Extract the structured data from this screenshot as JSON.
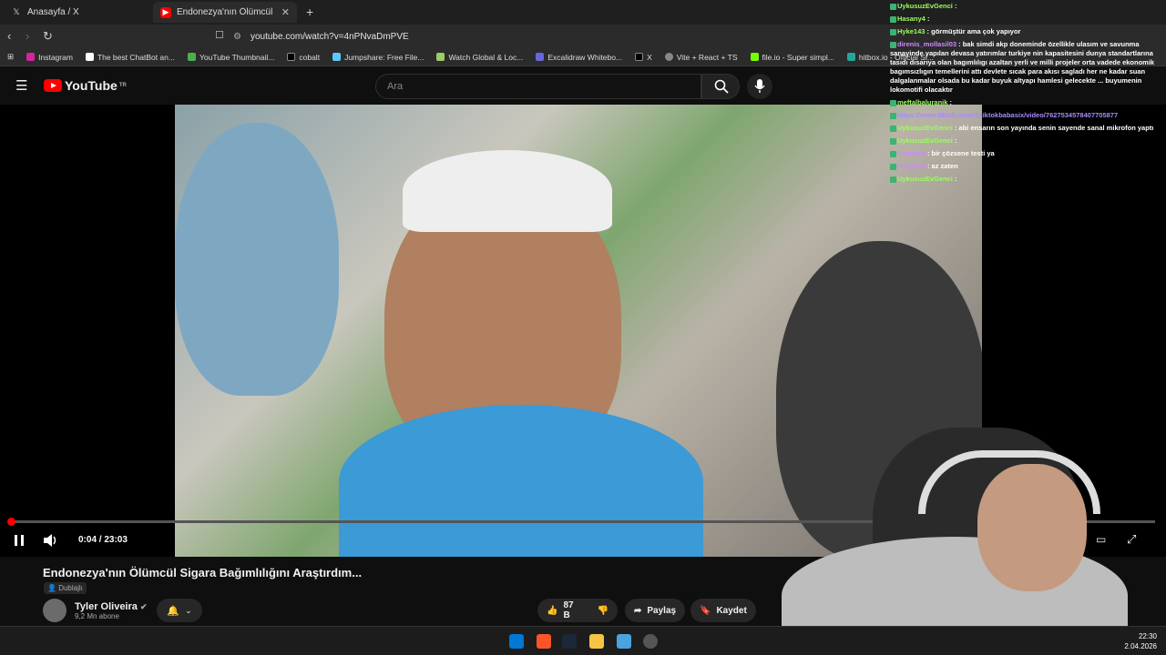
{
  "browser": {
    "tabs": [
      {
        "label": "Anasayfa / X"
      },
      {
        "label": "Endonezya'nın Ölümcül Sigar"
      }
    ],
    "url": "youtube.com/watch?v=4nPNvaDmPVE",
    "bookmarks": [
      "Instagram",
      "The best ChatBot an...",
      "YouTube Thumbnail...",
      "cobalt",
      "Jumpshare: Free File...",
      "Watch Global & Loc...",
      "Excalidraw Whitebo...",
      "X",
      "Vite + React + TS",
      "file.io - Super simpl...",
      "hitbox.io - Official Si..."
    ]
  },
  "youtube": {
    "logo": "YouTube",
    "region": "TR",
    "search_placeholder": "Ara",
    "time": "0:04 / 23:03",
    "progress": 0.003,
    "title": "Endonezya'nın Ölümcül Sigara Bağımlılığını Araştırdım...",
    "dub_label": "Dublajlı",
    "channel": "Tyler Oliveira",
    "subscribers": "9,2 Mn abone",
    "likes": "87 B",
    "share": "Paylaş",
    "save": "Kaydet"
  },
  "chat": [
    {
      "user": "UykusuzEvGenci",
      "text": ":",
      "color": "#9aff5c"
    },
    {
      "user": "Hasany4",
      "text": ":",
      "color": "#9aff5c"
    },
    {
      "user": "Hyke143",
      "text": ": görmüştür ama çok yapıyor",
      "color": "#9aff5c"
    },
    {
      "user": "direnis_mollasil03",
      "text": ": bak simdi akp doneminde özellikle ulasım ve savunma sanayinde yapılan devasa yatırımlar turkiye nin kapasitesini dunya standartlarına tasıdı dısarıya olan bagımlılıgı azaltan yerli ve milli projeler orta vadede ekonomik bagımsızlıgın temellerini attı devlete sıcak para akısı sagladı her ne kadar suan dalgalanmalar olsada bu kadar buyuk altyapı hamlesi gelecekte ... buyumenin lokomotifi olacaktır",
      "color": "#c8f"
    },
    {
      "user": "meftalbaluranik",
      "text": ":",
      "color": "#9aff5c"
    },
    {
      "user": "",
      "text": "https://www.tiktok.com/@tiktokbabasix/video/7627534578407705877",
      "color": "#a78bfa"
    },
    {
      "user": "UykusuzEvGenci",
      "text": ": abi ensarın son yayında senin sayende sanal mikrofon yaptı",
      "color": "#9aff5c"
    },
    {
      "user": "UykusuzEvGenci",
      "text": ":",
      "color": "#9aff5c"
    },
    {
      "user": "Hasany4",
      "text": ": bir çözsene testi ya",
      "color": "#c8f"
    },
    {
      "user": "Hasany4",
      "text": ": az zaten",
      "color": "#c8f"
    },
    {
      "user": "UykusuzEvGenci",
      "text": ":",
      "color": "#9aff5c"
    }
  ],
  "taskbar": {
    "time": "22:30",
    "date": "2.04.2026"
  }
}
